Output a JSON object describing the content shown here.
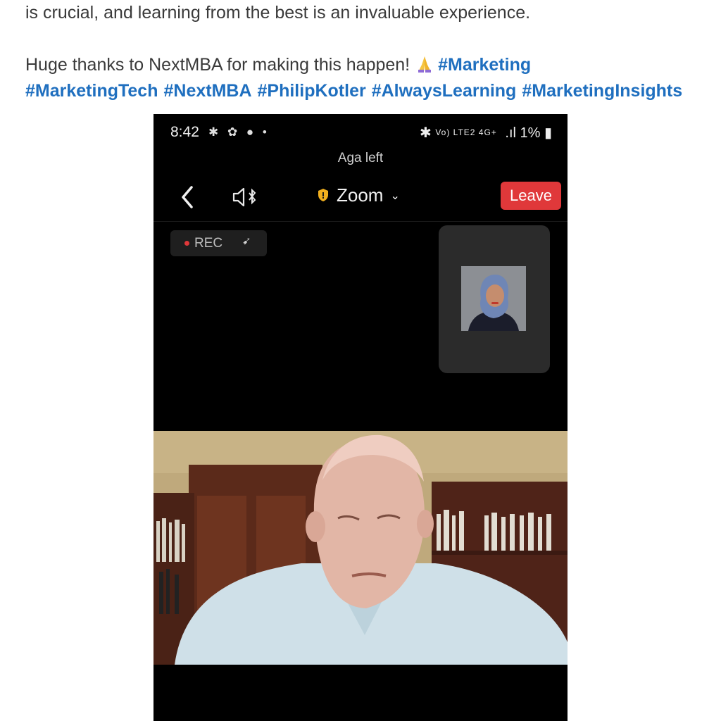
{
  "post": {
    "line1": "is crucial, and learning from the best is an invaluable experience.",
    "thanks": "Huge thanks to NextMBA for making this happen!",
    "emoji": "folded-hands-emoji",
    "hashtags": [
      "#Marketing",
      "#MarketingTech",
      "#NextMBA",
      "#PhilipKotler",
      "#AlwaysLearning",
      "#MarketingInsights"
    ]
  },
  "phone": {
    "status": {
      "time": "8:42",
      "left_icons": "bluetooth-icon, settings-icon, app-icon, dot",
      "network_label": "Vo) LTE2 4G+",
      "battery": "1%"
    },
    "notice": "Aga left",
    "toolbar": {
      "back_icon": "back-chevron-icon",
      "speaker_icon": "speaker-bluetooth-icon",
      "title": "Zoom",
      "leave": "Leave"
    },
    "rec": {
      "label": "REC"
    },
    "colors": {
      "leave": "#e0383a",
      "hashtag": "#1f6fbf",
      "rec_dot": "#e0383a"
    }
  }
}
